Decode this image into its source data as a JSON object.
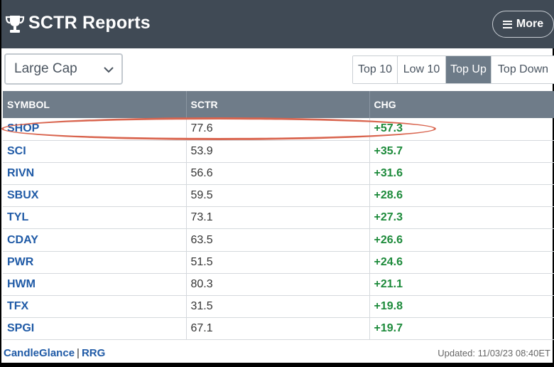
{
  "header": {
    "title": "SCTR Reports",
    "more_label": "More",
    "background": "#404a55"
  },
  "filter": {
    "selected": "Large Cap"
  },
  "tabs": [
    {
      "label": "Top 10",
      "active": false
    },
    {
      "label": "Low 10",
      "active": false
    },
    {
      "label": "Top Up",
      "active": true
    },
    {
      "label": "Top Down",
      "active": false
    }
  ],
  "table": {
    "headers": [
      "SYMBOL",
      "SCTR",
      "CHG"
    ],
    "rows": [
      {
        "symbol": "SHOP",
        "sctr": "77.6",
        "chg": "+57.3"
      },
      {
        "symbol": "SCI",
        "sctr": "53.9",
        "chg": "+35.7"
      },
      {
        "symbol": "RIVN",
        "sctr": "56.6",
        "chg": "+31.6"
      },
      {
        "symbol": "SBUX",
        "sctr": "59.5",
        "chg": "+28.6"
      },
      {
        "symbol": "TYL",
        "sctr": "73.1",
        "chg": "+27.3"
      },
      {
        "symbol": "CDAY",
        "sctr": "63.5",
        "chg": "+26.6"
      },
      {
        "symbol": "PWR",
        "sctr": "51.5",
        "chg": "+24.6"
      },
      {
        "symbol": "HWM",
        "sctr": "80.3",
        "chg": "+21.1"
      },
      {
        "symbol": "TFX",
        "sctr": "31.5",
        "chg": "+19.8"
      },
      {
        "symbol": "SPGI",
        "sctr": "67.1",
        "chg": "+19.7"
      }
    ]
  },
  "footer": {
    "link1": "CandleGlance",
    "separator": "|",
    "link2": "RRG",
    "updated": "Updated: 11/03/23 08:40ET"
  },
  "colors": {
    "link": "#1f5aa6",
    "positive": "#1c8a3a",
    "highlight_oval": "#d9654f",
    "active_tab": "#6d7b88"
  },
  "icons": {
    "trophy": "trophy-icon",
    "menu": "hamburger-icon",
    "dropdown": "chevron-down-icon"
  }
}
